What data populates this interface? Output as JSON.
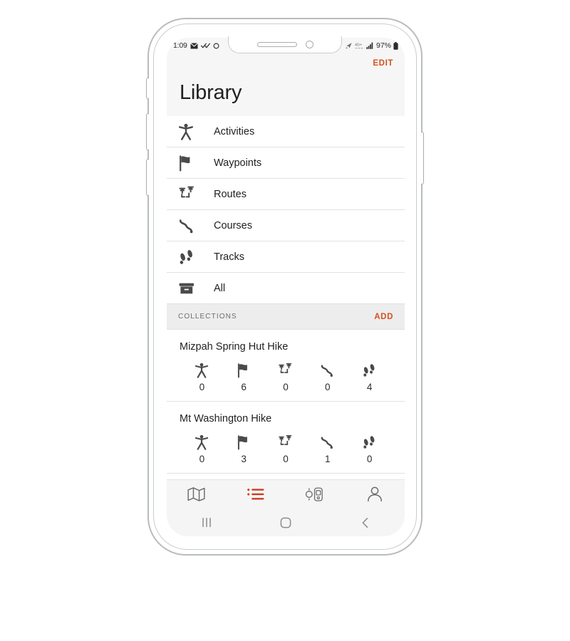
{
  "status_bar": {
    "time": "1:09",
    "left_icons": [
      "mail-icon",
      "double-check-icon",
      "sync-circle-icon"
    ],
    "right_icons": [
      "location-icon",
      "network-4g-icon",
      "signal-bars-icon"
    ],
    "battery_percent": "97%",
    "battery_icon": "battery-full-icon"
  },
  "header": {
    "title": "Library",
    "edit_label": "EDIT"
  },
  "nav_rows": [
    {
      "label": "Activities",
      "icon": "activity-person-icon"
    },
    {
      "label": "Waypoints",
      "icon": "flag-icon"
    },
    {
      "label": "Routes",
      "icon": "route-pins-icon"
    },
    {
      "label": "Courses",
      "icon": "course-path-icon"
    },
    {
      "label": "Tracks",
      "icon": "footprints-icon"
    },
    {
      "label": "All",
      "icon": "archive-box-icon"
    }
  ],
  "collections_section": {
    "label": "COLLECTIONS",
    "add_label": "ADD"
  },
  "collections": [
    {
      "title": "Mizpah Spring Hut Hike",
      "stats": [
        {
          "icon": "activity-person-icon",
          "value": "0"
        },
        {
          "icon": "flag-icon",
          "value": "6"
        },
        {
          "icon": "route-pins-icon",
          "value": "0"
        },
        {
          "icon": "course-path-icon",
          "value": "0"
        },
        {
          "icon": "footprints-icon",
          "value": "4"
        }
      ]
    },
    {
      "title": "Mt Washington Hike",
      "stats": [
        {
          "icon": "activity-person-icon",
          "value": "0"
        },
        {
          "icon": "flag-icon",
          "value": "3"
        },
        {
          "icon": "route-pins-icon",
          "value": "0"
        },
        {
          "icon": "course-path-icon",
          "value": "1"
        },
        {
          "icon": "footprints-icon",
          "value": "0"
        }
      ]
    }
  ],
  "tab_bar": {
    "tabs": [
      {
        "name": "map-tab",
        "icon": "map-icon",
        "active": false
      },
      {
        "name": "library-tab",
        "icon": "list-icon",
        "active": true
      },
      {
        "name": "devices-tab",
        "icon": "devices-icon",
        "active": false
      },
      {
        "name": "profile-tab",
        "icon": "person-icon",
        "active": false
      }
    ]
  },
  "android_nav": {
    "buttons": [
      "recents-icon",
      "home-icon",
      "back-icon"
    ]
  },
  "colors": {
    "accent": "#d4521e",
    "icon_gray": "#4a4a4a",
    "tab_inactive": "#6b6b6b",
    "header_bg": "#f6f6f6",
    "section_bg": "#ededed"
  }
}
